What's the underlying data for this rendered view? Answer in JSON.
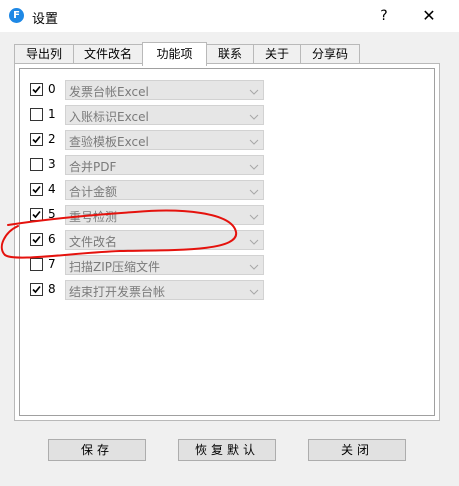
{
  "window": {
    "title": "设置",
    "icon": "F",
    "help_label": "?",
    "close_label": "✕"
  },
  "tabs": [
    {
      "label": "导出列"
    },
    {
      "label": "文件改名"
    },
    {
      "label": "功能项",
      "active": true
    },
    {
      "label": "联系"
    },
    {
      "label": "关于"
    },
    {
      "label": "分享码"
    }
  ],
  "features": [
    {
      "num": "0",
      "checked": true,
      "value": "发票台帐Excel"
    },
    {
      "num": "1",
      "checked": false,
      "value": "入账标识Excel"
    },
    {
      "num": "2",
      "checked": true,
      "value": "查验模板Excel"
    },
    {
      "num": "3",
      "checked": false,
      "value": "合并PDF"
    },
    {
      "num": "4",
      "checked": true,
      "value": "合计金额"
    },
    {
      "num": "5",
      "checked": true,
      "value": "重号检测"
    },
    {
      "num": "6",
      "checked": true,
      "value": "文件改名"
    },
    {
      "num": "7",
      "checked": false,
      "value": "扫描ZIP压缩文件"
    },
    {
      "num": "8",
      "checked": true,
      "value": "结束打开发票台帐"
    }
  ],
  "buttons": {
    "save": "保存",
    "restore": "恢复默认",
    "close": "关闭"
  },
  "colors": {
    "annotation": "#e5120d",
    "icon": "#1e88e5"
  },
  "icons": [
    "app-logo-icon",
    "help-icon",
    "close-icon",
    "checkmark-icon",
    "chevron-down-icon"
  ]
}
